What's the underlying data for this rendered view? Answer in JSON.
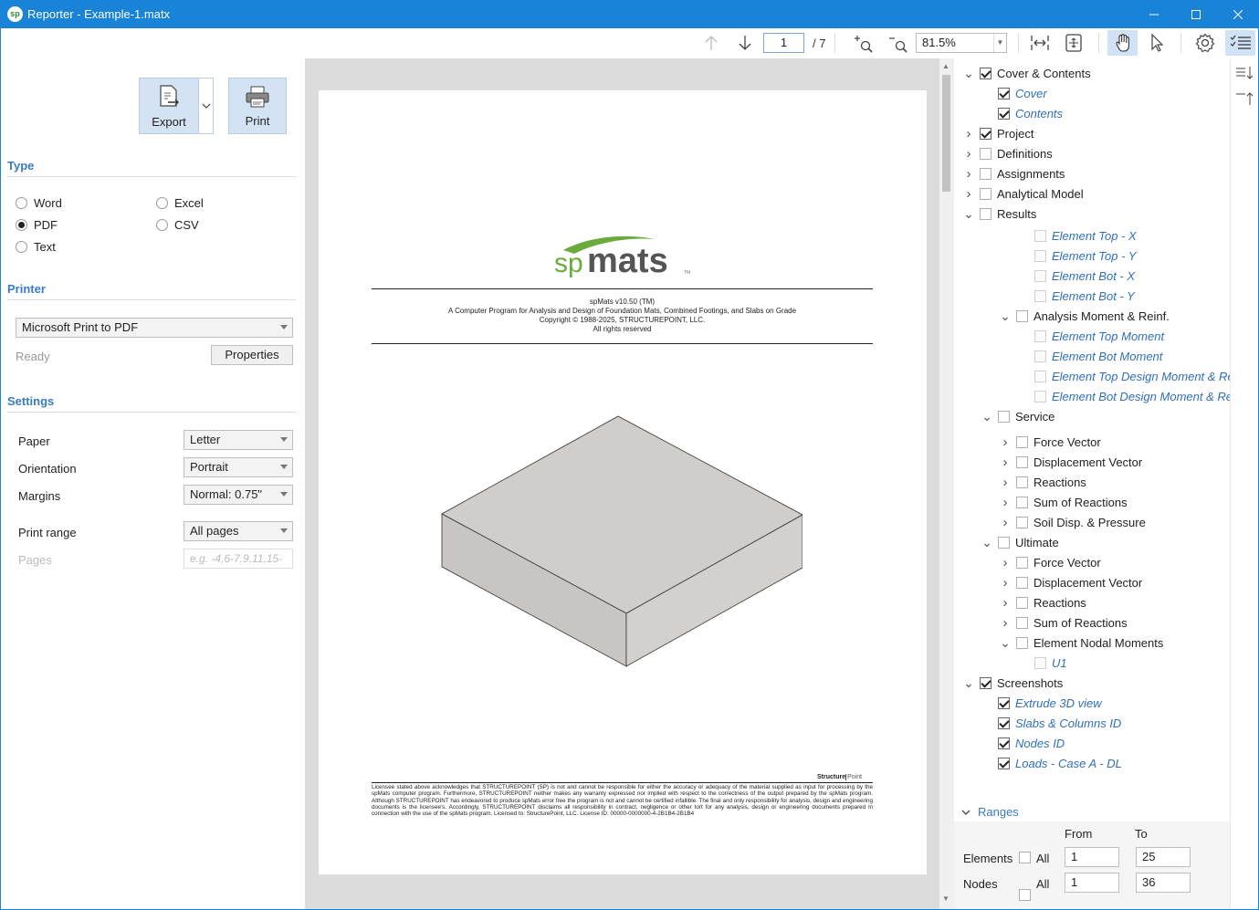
{
  "window": {
    "title": "Reporter - Example-1.matx",
    "app_icon": "sp"
  },
  "toolbar": {
    "page_current": "1",
    "page_total": "/ 7",
    "zoom": "81.5%"
  },
  "export": {
    "export_label": "Export",
    "print_label": "Print"
  },
  "type": {
    "title": "Type",
    "options": [
      {
        "label": "Word",
        "selected": false
      },
      {
        "label": "Excel",
        "selected": false
      },
      {
        "label": "PDF",
        "selected": true
      },
      {
        "label": "CSV",
        "selected": false
      },
      {
        "label": "Text",
        "selected": false
      }
    ]
  },
  "printer": {
    "title": "Printer",
    "device": "Microsoft Print to PDF",
    "status": "Ready",
    "properties_label": "Properties"
  },
  "settings": {
    "title": "Settings",
    "paper_label": "Paper",
    "paper_value": "Letter",
    "orientation_label": "Orientation",
    "orientation_value": "Portrait",
    "margins_label": "Margins",
    "margins_value": "Normal: 0.75\"",
    "range_label": "Print range",
    "range_value": "All pages",
    "pages_label": "Pages",
    "pages_placeholder": "e.g. -4,6-7,9,11,15-"
  },
  "document": {
    "logo_sp": "sp",
    "logo_mats": "mats",
    "logo_tm": "TM",
    "heading1": "spMats v10.50 (TM)",
    "heading2": "A Computer Program for Analysis and Design of Foundation Mats, Combined Footings, and Slabs on Grade",
    "heading3": "Copyright © 1988-2025, STRUCTUREPOINT, LLC.",
    "heading4": "All rights reserved",
    "footer_brand_a": "Structure",
    "footer_brand_b": "Point",
    "disclaimer": "Licensee stated above acknowledges that STRUCTUREPOINT (SP) is not and cannot be responsible for either the accuracy or adequacy of the material supplied as input for processing by the spMats computer program. Furthermore, STRUCTUREPOINT neither makes any warranty expressed nor implied with respect to the correctness of the output prepared by the spMats program. Although STRUCTUREPOINT has endeavored to produce spMats error free the program is not and cannot be certified infallible. The final and only responsibility for analysis, design and engineering documents is the licensee's. Accordingly, STRUCTUREPOINT disclaims all responsibility in contract, negligence or other tort for any analysis, design or engineering documents prepared in connection with the use of the spMats program. Licensed to: StructurePoint, LLC. License ID: 00000-0000000-4-2B1B4-2B1B4"
  },
  "tree": [
    {
      "label": "Cover & Contents",
      "level": 0,
      "expander": "down",
      "checked": true,
      "style": "normal"
    },
    {
      "label": "Cover",
      "level": 1,
      "expander": "none",
      "checked": true,
      "style": "leaf"
    },
    {
      "label": "Contents",
      "level": 1,
      "expander": "none",
      "checked": true,
      "style": "leaf"
    },
    {
      "label": "Project",
      "level": 0,
      "expander": "right",
      "checked": true,
      "style": "normal"
    },
    {
      "label": "Definitions",
      "level": 0,
      "expander": "right",
      "checked": false,
      "style": "normal"
    },
    {
      "label": "Assignments",
      "level": 0,
      "expander": "right",
      "checked": false,
      "style": "normal"
    },
    {
      "label": "Analytical Model",
      "level": 0,
      "expander": "right",
      "checked": false,
      "style": "normal"
    },
    {
      "label": "Results",
      "level": 0,
      "expander": "down",
      "checked": false,
      "style": "normal"
    },
    {
      "label": "Element Top - X",
      "level": 3,
      "expander": "none",
      "checked": false,
      "style": "leaf"
    },
    {
      "label": "Element Top - Y",
      "level": 3,
      "expander": "none",
      "checked": false,
      "style": "leaf"
    },
    {
      "label": "Element Bot - X",
      "level": 3,
      "expander": "none",
      "checked": false,
      "style": "leaf"
    },
    {
      "label": "Element Bot - Y",
      "level": 3,
      "expander": "none",
      "checked": false,
      "style": "leaf"
    },
    {
      "label": "Analysis Moment & Reinf.",
      "level": 2,
      "expander": "down",
      "checked": false,
      "style": "normal"
    },
    {
      "label": "Element Top Moment",
      "level": 3,
      "expander": "none",
      "checked": false,
      "style": "leaf"
    },
    {
      "label": "Element Bot Moment",
      "level": 3,
      "expander": "none",
      "checked": false,
      "style": "leaf"
    },
    {
      "label": "Element Top Design Moment & Reinf.",
      "level": 3,
      "expander": "none",
      "checked": false,
      "style": "leaf"
    },
    {
      "label": "Element Bot Design Moment & Reinf.",
      "level": 3,
      "expander": "none",
      "checked": false,
      "style": "leaf"
    },
    {
      "label": "Service",
      "level": 1,
      "expander": "down",
      "checked": false,
      "style": "normal"
    },
    {
      "label": "Force Vector",
      "level": 2,
      "expander": "right",
      "checked": false,
      "style": "normal"
    },
    {
      "label": "Displacement Vector",
      "level": 2,
      "expander": "right",
      "checked": false,
      "style": "normal"
    },
    {
      "label": "Reactions",
      "level": 2,
      "expander": "right",
      "checked": false,
      "style": "normal"
    },
    {
      "label": "Sum of Reactions",
      "level": 2,
      "expander": "right",
      "checked": false,
      "style": "normal"
    },
    {
      "label": "Soil Disp. & Pressure",
      "level": 2,
      "expander": "right",
      "checked": false,
      "style": "normal"
    },
    {
      "label": "Ultimate",
      "level": 1,
      "expander": "down",
      "checked": false,
      "style": "normal"
    },
    {
      "label": "Force Vector",
      "level": 2,
      "expander": "right",
      "checked": false,
      "style": "normal"
    },
    {
      "label": "Displacement Vector",
      "level": 2,
      "expander": "right",
      "checked": false,
      "style": "normal"
    },
    {
      "label": "Reactions",
      "level": 2,
      "expander": "right",
      "checked": false,
      "style": "normal"
    },
    {
      "label": "Sum of Reactions",
      "level": 2,
      "expander": "right",
      "checked": false,
      "style": "normal"
    },
    {
      "label": "Element Nodal Moments",
      "level": 2,
      "expander": "down",
      "checked": false,
      "style": "normal"
    },
    {
      "label": "U1",
      "level": 3,
      "expander": "none",
      "checked": false,
      "style": "leaf"
    },
    {
      "label": "Screenshots",
      "level": 0,
      "expander": "down",
      "checked": true,
      "style": "normal"
    },
    {
      "label": "Extrude 3D view",
      "level": 1,
      "expander": "none",
      "checked": true,
      "style": "leaf"
    },
    {
      "label": "Slabs & Columns ID",
      "level": 1,
      "expander": "none",
      "checked": true,
      "style": "leaf"
    },
    {
      "label": "Nodes ID",
      "level": 1,
      "expander": "none",
      "checked": true,
      "style": "leaf"
    },
    {
      "label": "Loads - Case A - DL",
      "level": 1,
      "expander": "none",
      "checked": true,
      "style": "leaf"
    }
  ],
  "ranges": {
    "title": "Ranges",
    "from_label": "From",
    "to_label": "To",
    "elements_label": "Elements",
    "elements_all": "All",
    "elements_from": "1",
    "elements_to": "25",
    "nodes_label": "Nodes",
    "nodes_all": "All",
    "nodes_from": "1",
    "nodes_to": "36"
  },
  "colors": {
    "titlebar": "#1883d7",
    "accent": "#3a7cc3",
    "logo_green": "#6aab3c",
    "logo_gray": "#555555"
  }
}
